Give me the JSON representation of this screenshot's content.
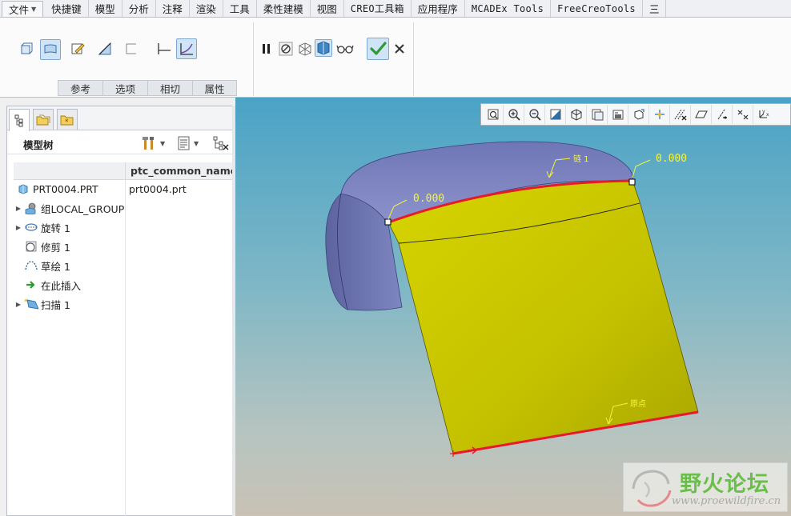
{
  "menubar": {
    "tabs": [
      {
        "label": "文件",
        "kind": "file"
      },
      {
        "label": "快捷键"
      },
      {
        "label": "模型"
      },
      {
        "label": "分析"
      },
      {
        "label": "注释"
      },
      {
        "label": "渲染"
      },
      {
        "label": "工具"
      },
      {
        "label": "柔性建模"
      },
      {
        "label": "视图"
      },
      {
        "label": "CREO工具箱",
        "mono": true
      },
      {
        "label": "应用程序"
      },
      {
        "label": "MCADEx Tools",
        "mono": true
      },
      {
        "label": "FreeCreoTools",
        "mono": true
      },
      {
        "label": "三"
      }
    ]
  },
  "ribbon": {
    "tabs": [
      "参考",
      "选项",
      "相切",
      "属性"
    ],
    "icons": [
      "solid-icon",
      "surface-icon",
      "sketch-icon",
      "thicken-icon",
      "open-end-icon",
      "constant-section-icon",
      "variable-section-icon",
      "pause-icon",
      "no-preview-icon",
      "mesh-preview-icon",
      "verify-preview-icon",
      "glasses-preview-icon",
      "confirm-check-icon",
      "cancel-x-icon"
    ],
    "colors": {
      "accent_green": "#3aa33a",
      "active_bg": "#cfe4f7"
    }
  },
  "tree": {
    "title": "模型树",
    "column_header": "ptc_common_name",
    "rows": [
      {
        "label": "PRT0004.PRT",
        "col": "prt0004.prt",
        "icon": "part-icon",
        "expandable": false,
        "indent": 0
      },
      {
        "label": "组LOCAL_GROUP",
        "col": "",
        "icon": "group-icon",
        "expandable": true,
        "indent": 1
      },
      {
        "label": "旋转 1",
        "col": "",
        "icon": "revolve-icon",
        "expandable": true,
        "indent": 1
      },
      {
        "label": "修剪 1",
        "col": "",
        "icon": "trim-icon",
        "expandable": false,
        "indent": 1
      },
      {
        "label": "草绘 1",
        "col": "",
        "icon": "sketch-icon",
        "expandable": false,
        "indent": 1
      },
      {
        "label": "在此插入",
        "col": "",
        "icon": "insert-here-icon",
        "expandable": false,
        "indent": 1
      },
      {
        "label": "扫描 1",
        "col": "",
        "icon": "sweep-icon",
        "expandable": true,
        "indent": 1
      }
    ]
  },
  "viewport": {
    "dim_left": "0.000",
    "dim_right": "0.000",
    "chain_label": "链 1",
    "origin_label": "原点",
    "view_tools": [
      "refit-icon",
      "zoom-in-icon",
      "zoom-out-icon",
      "repaint-icon",
      "display-style-icon",
      "saved-views-icon",
      "view-manager-icon",
      "perspective-icon",
      "spin-center-icon",
      "datum-display-icon",
      "plane-display-icon",
      "axis-display-icon",
      "point-display-icon",
      "csys-display-icon"
    ],
    "colors": {
      "surface_yellow": "#c9c600",
      "surface_blue": "#7f86c2",
      "edge_red": "#e8192a",
      "annotation_yellow": "#f5f53a"
    }
  },
  "watermark": {
    "title": "野火论坛",
    "url": "www.proewildfire.cn"
  }
}
